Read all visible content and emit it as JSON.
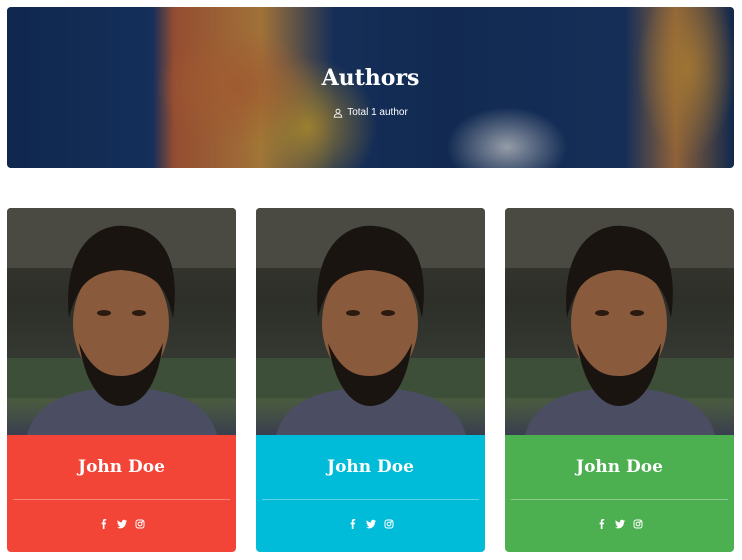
{
  "header": {
    "title": "Authors",
    "subtitle": "Total 1 author"
  },
  "authors": [
    {
      "name": "John Doe",
      "color": "#f24437"
    },
    {
      "name": "John Doe",
      "color": "#00bcd9"
    },
    {
      "name": "John Doe",
      "color": "#4caf50"
    }
  ],
  "social_icons": [
    "facebook-icon",
    "twitter-icon",
    "instagram-icon"
  ]
}
